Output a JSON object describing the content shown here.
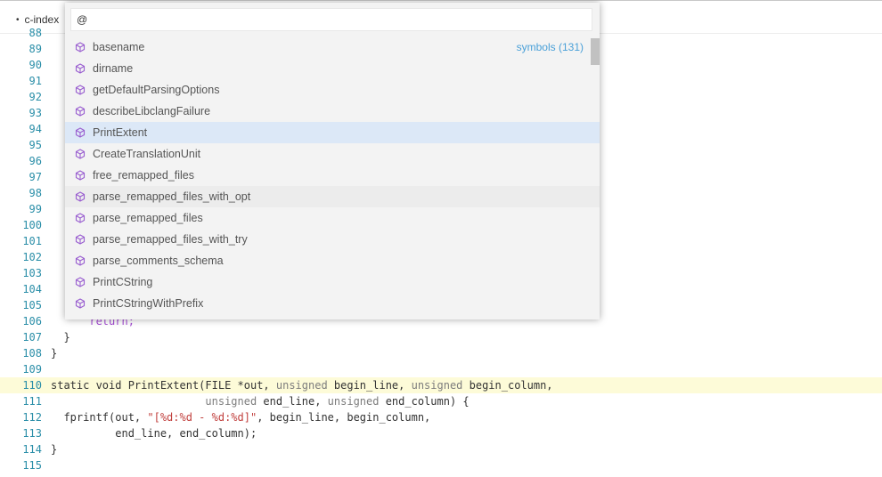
{
  "tab": {
    "title": "c-index",
    "dirty_marker": "•"
  },
  "quick_open": {
    "input_value": "@",
    "group_label": "symbols (131)",
    "items": [
      {
        "label": "basename",
        "icon": "symbol-icon"
      },
      {
        "label": "dirname",
        "icon": "symbol-icon"
      },
      {
        "label": "getDefaultParsingOptions",
        "icon": "symbol-icon"
      },
      {
        "label": "describeLibclangFailure",
        "icon": "symbol-icon"
      },
      {
        "label": "PrintExtent",
        "icon": "symbol-icon"
      },
      {
        "label": "CreateTranslationUnit",
        "icon": "symbol-icon"
      },
      {
        "label": "free_remapped_files",
        "icon": "symbol-icon"
      },
      {
        "label": "parse_remapped_files_with_opt",
        "icon": "symbol-icon"
      },
      {
        "label": "parse_remapped_files",
        "icon": "symbol-icon"
      },
      {
        "label": "parse_remapped_files_with_try",
        "icon": "symbol-icon"
      },
      {
        "label": "parse_comments_schema",
        "icon": "symbol-icon"
      },
      {
        "label": "PrintCString",
        "icon": "symbol-icon"
      },
      {
        "label": "PrintCStringWithPrefix",
        "icon": "symbol-icon"
      }
    ],
    "selected_index": 4,
    "hover_index": 7,
    "icon_color": "#9a5fd0"
  },
  "editor": {
    "line_numbers": [
      "88",
      "89",
      "90",
      "91",
      "92",
      "93",
      "94",
      "95",
      "96",
      "97",
      "98",
      "99",
      "100",
      "101",
      "102",
      "103",
      "104",
      "105",
      "106",
      "107",
      "108",
      "109",
      "110",
      "111",
      "112",
      "113",
      "114",
      "115"
    ],
    "lines": {
      "106": "      return;",
      "107": "  }",
      "108": "}",
      "110_a": "static void PrintExtent(FILE *out, ",
      "110_b": "unsigned",
      "110_c": " begin_line, ",
      "110_d": "unsigned",
      "110_e": " begin_column,",
      "111_a": "                        ",
      "111_b": "unsigned",
      "111_c": " end_line, ",
      "111_d": "unsigned",
      "111_e": " end_column) {",
      "112_a": "  fprintf(out, ",
      "112_b": "\"[%d:%d - %d:%d]\"",
      "112_c": ", begin_line, begin_column,",
      "113": "          end_line, end_column);",
      "114": "}"
    },
    "highlight_line": "110"
  }
}
